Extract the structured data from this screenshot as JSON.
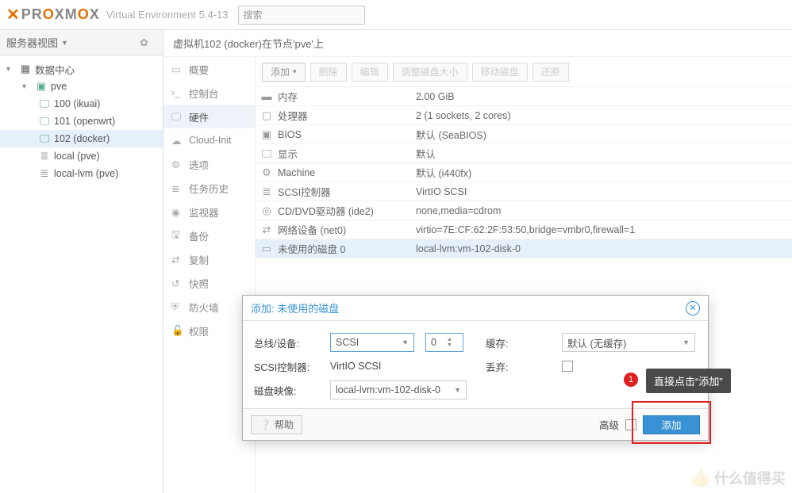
{
  "header": {
    "brand": "PROXMOX",
    "env_text": "Virtual Environment 5.4-13",
    "search_placeholder": "搜索"
  },
  "sidebar": {
    "view_label": "服务器视图",
    "tree": {
      "datacenter": "数据中心",
      "node": "pve",
      "vms": [
        {
          "label": "100 (ikuai)"
        },
        {
          "label": "101 (openwrt)"
        },
        {
          "label": "102 (docker)"
        }
      ],
      "storage": [
        {
          "label": "local (pve)"
        },
        {
          "label": "local-lvm (pve)"
        }
      ]
    }
  },
  "breadcrumb": "虚拟机102 (docker)在节点'pve'上",
  "inner_nav": [
    "概要",
    "控制台",
    "硬件",
    "Cloud-Init",
    "选项",
    "任务历史",
    "监视器",
    "备份",
    "复制",
    "快照",
    "防火墙",
    "权限"
  ],
  "toolbar": {
    "add": "添加",
    "remove": "删除",
    "edit": "编辑",
    "resize": "调整磁盘大小",
    "move": "移动磁盘",
    "restore": "还原"
  },
  "hardware": [
    {
      "icon": "memory",
      "label": "内存",
      "value": "2.00 GiB"
    },
    {
      "icon": "cpu",
      "label": "处理器",
      "value": "2 (1 sockets, 2 cores)"
    },
    {
      "icon": "bios",
      "label": "BIOS",
      "value": "默认 (SeaBIOS)"
    },
    {
      "icon": "display",
      "label": "显示",
      "value": "默认"
    },
    {
      "icon": "machine",
      "label": "Machine",
      "value": "默认 (i440fx)"
    },
    {
      "icon": "scsi",
      "label": "SCSI控制器",
      "value": "VirtIO SCSI"
    },
    {
      "icon": "cd",
      "label": "CD/DVD驱动器 (ide2)",
      "value": "none,media=cdrom"
    },
    {
      "icon": "net",
      "label": "网络设备 (net0)",
      "value": "virtio=7E:CF:62:2F:53:50,bridge=vmbr0,firewall=1"
    },
    {
      "icon": "disk",
      "label": "未使用的磁盘 0",
      "value": "local-lvm:vm-102-disk-0"
    }
  ],
  "dialog": {
    "title": "添加: 未使用的磁盘",
    "labels": {
      "bus": "总线/设备:",
      "scsi_ctrl": "SCSI控制器:",
      "disk_image": "磁盘映像:",
      "cache": "缓存:",
      "discard": "丢弃:",
      "advanced": "高级"
    },
    "values": {
      "bus_type": "SCSI",
      "bus_number": "0",
      "scsi_ctrl": "VirtIO SCSI",
      "disk_image": "local-lvm:vm-102-disk-0",
      "cache": "默认 (无缓存)"
    },
    "buttons": {
      "help": "帮助",
      "add": "添加"
    }
  },
  "annotations": {
    "badge": "1",
    "callout": "直接点击“添加”"
  },
  "watermark": "什么值得买"
}
